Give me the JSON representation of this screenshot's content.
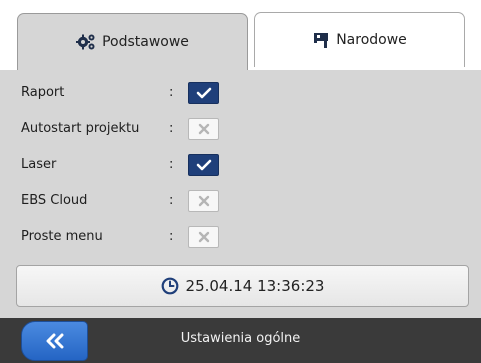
{
  "tabs": [
    {
      "label": "Podstawowe",
      "icon": "gears-icon",
      "active": true
    },
    {
      "label": "Narodowe",
      "icon": "flag-icon",
      "active": false
    }
  ],
  "settings": [
    {
      "label": "Raport",
      "separator": ":",
      "checked": true
    },
    {
      "label": "Autostart projektu",
      "separator": ":",
      "checked": false
    },
    {
      "label": "Laser",
      "separator": ":",
      "checked": true
    },
    {
      "label": "EBS Cloud",
      "separator": ":",
      "checked": false
    },
    {
      "label": "Proste menu",
      "separator": ":",
      "checked": false
    }
  ],
  "datetime": {
    "value": "25.04.14 13:36:23",
    "icon": "clock-icon"
  },
  "bottom_bar": {
    "title": "Ustawienia ogólne",
    "back_icon": "double-chevron-left-icon"
  },
  "colors": {
    "checkbox_on": "#1f3f7a",
    "back_button": "#2f6fd0",
    "bottom_bar": "#3a3a3a",
    "panel_bg": "#d6d6d6"
  }
}
